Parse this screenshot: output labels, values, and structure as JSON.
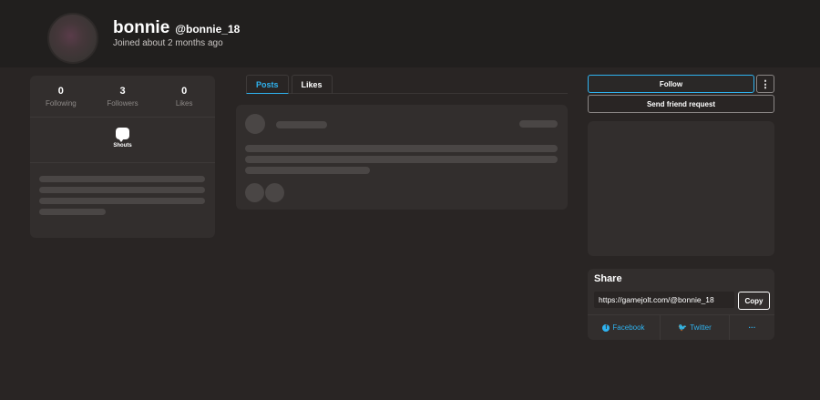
{
  "profile": {
    "display_name": "bonnie",
    "username": "@bonnie_18",
    "joined": "Joined about 2 months ago"
  },
  "stats": [
    {
      "value": "0",
      "label": "Following"
    },
    {
      "value": "3",
      "label": "Followers"
    },
    {
      "value": "0",
      "label": "Likes"
    }
  ],
  "shouts": {
    "label": "Shouts",
    "icon": "speech-bubble-icon"
  },
  "tabs": [
    {
      "label": "Posts",
      "active": true
    },
    {
      "label": "Likes",
      "active": false
    }
  ],
  "actions": {
    "follow_label": "Follow",
    "more_label": "⋮",
    "friend_request_label": "Send friend request"
  },
  "share": {
    "title": "Share",
    "url": "https://gamejolt.com/@bonnie_18",
    "copy_label": "Copy",
    "facebook_label": "Facebook",
    "twitter_label": "Twitter",
    "more_label": "···"
  },
  "colors": {
    "background": "#292524",
    "card": "#322e2d",
    "accent": "#2fb3f0",
    "skeleton": "#4a4645"
  }
}
